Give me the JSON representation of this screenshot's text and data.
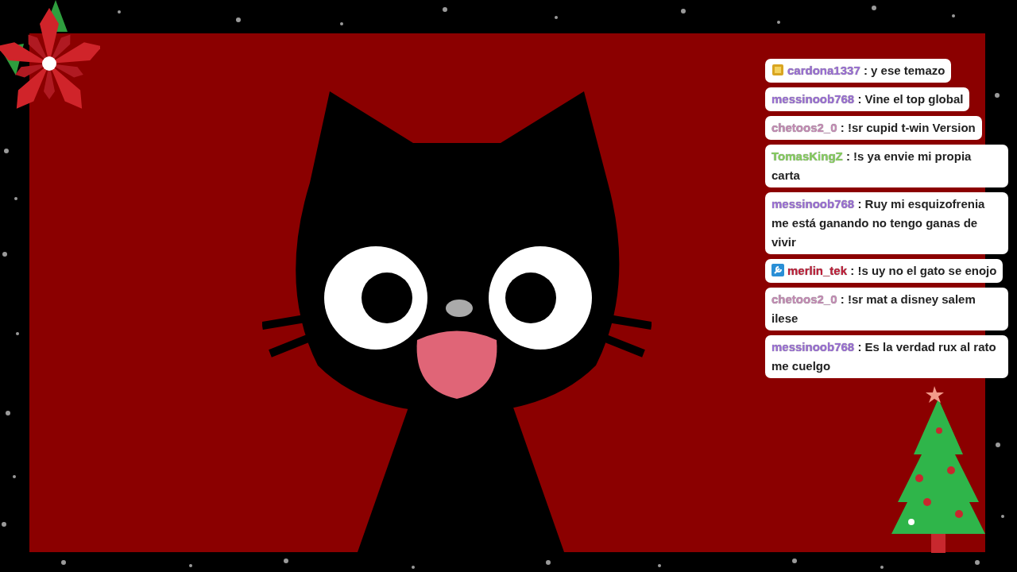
{
  "chat": {
    "messages": [
      {
        "kind": "subscriber",
        "user": "cardona1337",
        "text": ": y ese temazo",
        "color": "#9b6fd6"
      },
      {
        "kind": "plain",
        "user": "messinoob768",
        "text": ": Vine el top global",
        "color": "#9b6fd6"
      },
      {
        "kind": "plain",
        "user": "chetoos2_0",
        "text": ": !sr cupid t-win Version",
        "color": "#c58bb5"
      },
      {
        "kind": "plain",
        "user": "TomasKingZ",
        "text": ": !s ya envie mi propia carta",
        "color": "#86d05e"
      },
      {
        "kind": "plain",
        "user": "messinoob768",
        "text": ": Ruy mi esquizofrenia me está ganando no tengo ganas de vivir",
        "color": "#9b6fd6"
      },
      {
        "kind": "moderator",
        "user": "merlin_tek",
        "text": ": !s uy no el gato se enojo",
        "color": "#c0203a"
      },
      {
        "kind": "plain",
        "user": "chetoos2_0",
        "text": ": !sr mat a disney salem ilese",
        "color": "#c58bb5"
      },
      {
        "kind": "plain",
        "user": "messinoob768",
        "text": ": Es la verdad rux al rato me cuelgo",
        "color": "#9b6fd6"
      }
    ]
  }
}
